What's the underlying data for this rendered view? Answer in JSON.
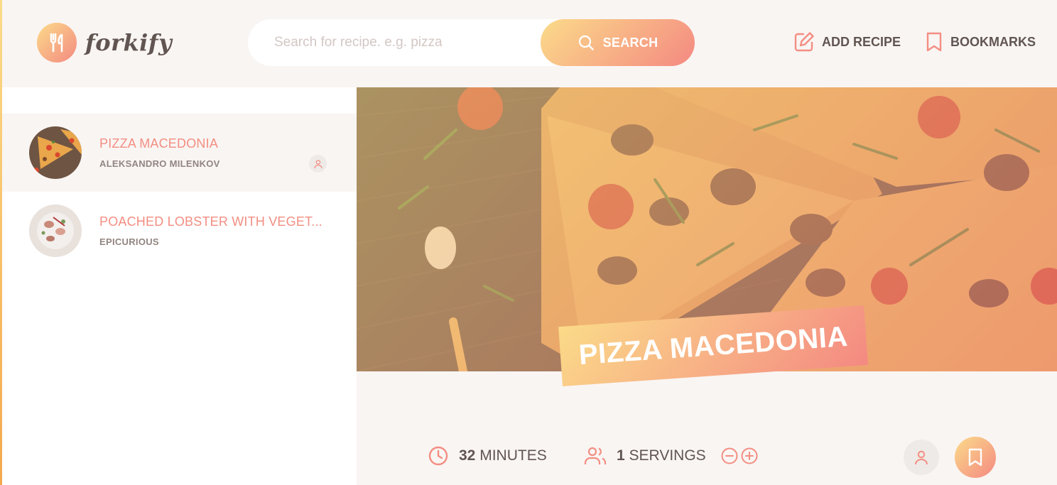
{
  "app": {
    "logo_text": "forkify"
  },
  "search": {
    "placeholder": "Search for recipe. e.g. pizza",
    "button_label": "SEARCH"
  },
  "nav": {
    "add_recipe": "ADD RECIPE",
    "bookmarks": "BOOKMARKS"
  },
  "results": [
    {
      "title": "PIZZA MACEDONIA",
      "publisher": "ALEKSANDRO MILENKOV",
      "user_generated": true
    },
    {
      "title": "POACHED LOBSTER WITH VEGET...",
      "publisher": "EPICURIOUS",
      "user_generated": false
    }
  ],
  "recipe": {
    "title": "PIZZA MACEDONIA",
    "cooking_time": "32",
    "time_unit": "MINUTES",
    "servings": "1",
    "servings_unit": "SERVINGS"
  },
  "colors": {
    "accent_start": "#fbdb89",
    "accent_end": "#f48982",
    "text": "#615551",
    "title": "#f38e82"
  },
  "icons": [
    "logo-fork-knife-icon",
    "search-icon",
    "edit-icon",
    "bookmark-icon",
    "user-icon",
    "clock-icon",
    "users-icon",
    "minus-circle-icon",
    "plus-circle-icon"
  ]
}
